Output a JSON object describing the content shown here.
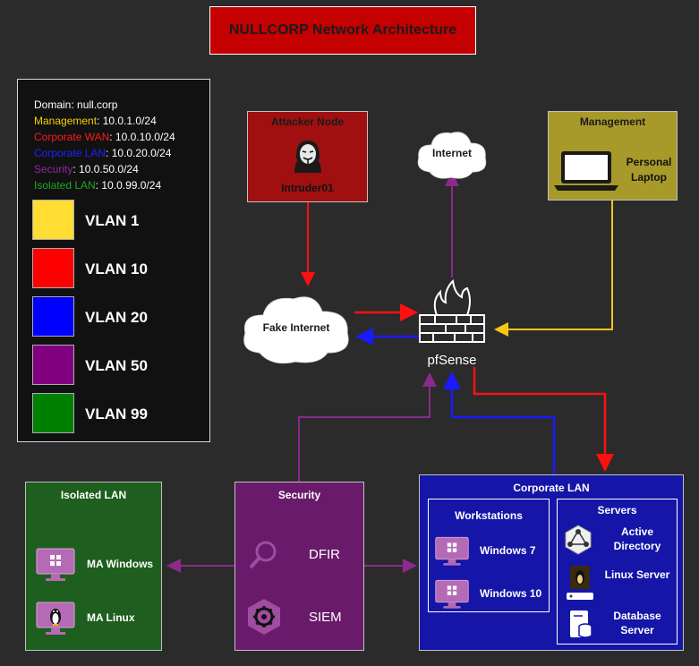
{
  "title": "NULLCORP Network Architecture",
  "legend": {
    "domain": "Domain: null.corp",
    "networks": [
      {
        "name": "Management",
        "cidr": ": 10.0.1.0/24",
        "color": "#f5d000"
      },
      {
        "name": "Corporate WAN",
        "cidr": ": 10.0.10.0/24",
        "color": "#ff1a1a"
      },
      {
        "name": "Corporate LAN",
        "cidr": ": 10.0.20.0/24",
        "color": "#2020ff"
      },
      {
        "name": "Security",
        "cidr": ": 10.0.50.0/24",
        "color": "#8a2b9a"
      },
      {
        "name": "Isolated LAN",
        "cidr": ": 10.0.99.0/24",
        "color": "#1fa81f"
      }
    ],
    "vlans": [
      {
        "label": "VLAN 1",
        "color": "#ffdd33"
      },
      {
        "label": "VLAN 10",
        "color": "#ff0000"
      },
      {
        "label": "VLAN 20",
        "color": "#0000ff"
      },
      {
        "label": "VLAN 50",
        "color": "#800080"
      },
      {
        "label": "VLAN 99",
        "color": "#008000"
      }
    ]
  },
  "attacker": {
    "title": "Attacker Node",
    "name": "Intruder01"
  },
  "internet": {
    "label": "Internet"
  },
  "fake_internet": {
    "label": "Fake Internet"
  },
  "firewall": {
    "label": "pfSense"
  },
  "management": {
    "title": "Management",
    "device": "Personal Laptop"
  },
  "isolated_lan": {
    "title": "Isolated LAN",
    "items": [
      "MA Windows",
      "MA Linux"
    ]
  },
  "security": {
    "title": "Security",
    "items": [
      "DFIR",
      "SIEM"
    ]
  },
  "corporate_lan": {
    "title": "Corporate LAN",
    "workstations": {
      "title": "Workstations",
      "items": [
        "Windows 7",
        "Windows 10"
      ]
    },
    "servers": {
      "title": "Servers",
      "items": [
        "Active Directory",
        "Linux Server",
        "Database Server"
      ]
    }
  },
  "colors": {
    "wan": "#ff1010",
    "lan": "#1a1aff",
    "mgmt": "#f5c518",
    "security": "#8b2a8b",
    "corp_panel": "#1515a8",
    "iso_panel": "#1e5e1e",
    "sec_panel": "#6a1a6a",
    "attacker_panel": "#a01010",
    "mgmt_panel": "#a89a2a"
  }
}
